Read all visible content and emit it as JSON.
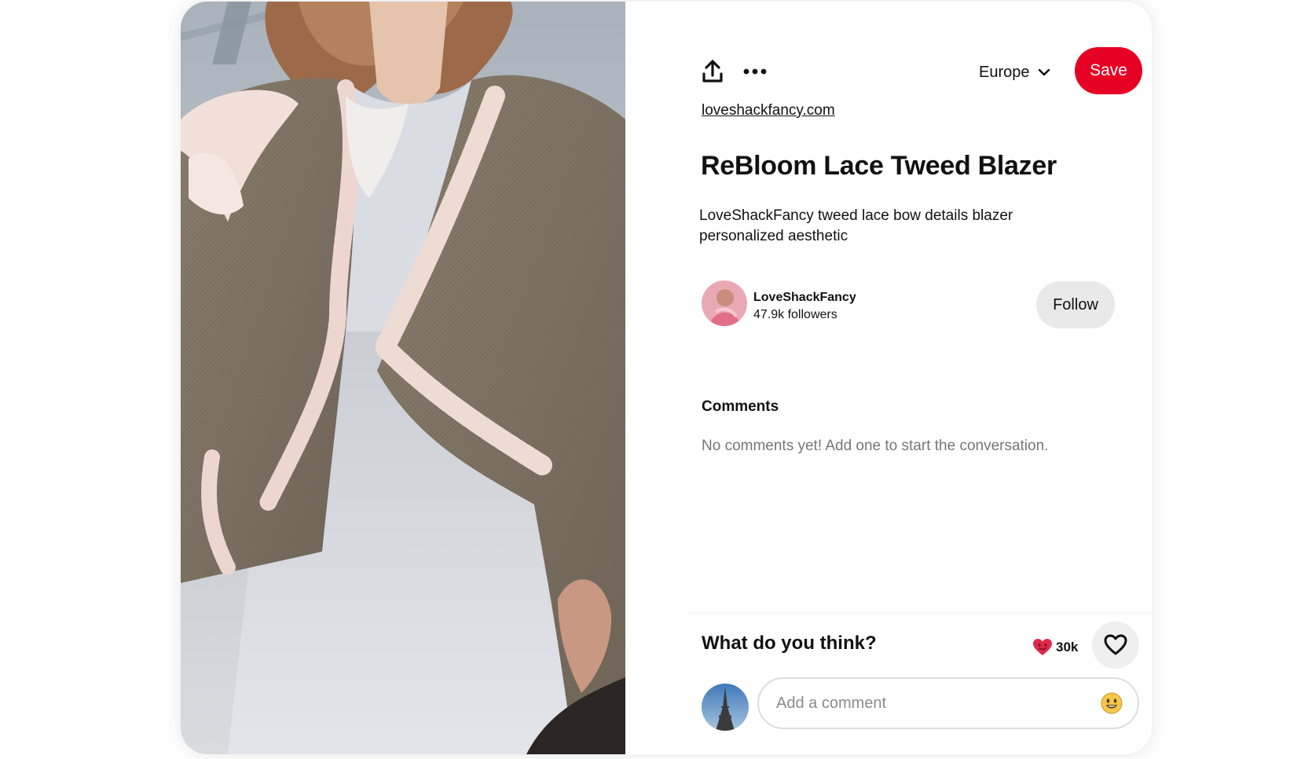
{
  "toolbar": {
    "share_icon": "share-upload-icon",
    "more_icon": "ellipsis-icon",
    "region_label": "Europe",
    "region_icon": "chevron-down-icon",
    "save_label": "Save"
  },
  "pin": {
    "source_link": "loveshackfancy.com",
    "title": "ReBloom Lace Tweed Blazer",
    "description": "LoveShackFancy tweed lace bow details blazer personalized aesthetic"
  },
  "creator": {
    "name": "LoveShackFancy",
    "followers": "47.9k followers",
    "follow_label": "Follow"
  },
  "comments": {
    "heading": "Comments",
    "empty_message": "No comments yet! Add one to start the conversation."
  },
  "footer": {
    "prompt": "What do you think?",
    "reaction_count": "30k",
    "reaction_icon": "heart-reaction-icon",
    "like_icon": "heart-outline-icon",
    "comment_placeholder": "Add a comment",
    "emoji_icon": "smiley-emoji-icon"
  },
  "colors": {
    "save_red": "#e60023",
    "follow_bg": "#e9e9e9",
    "muted_text": "#767676"
  }
}
